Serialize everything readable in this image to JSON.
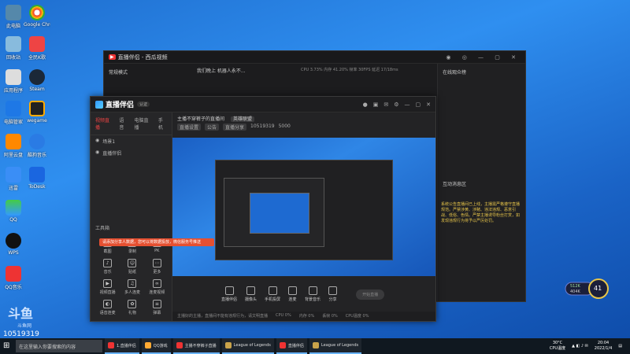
{
  "desktop_icons": [
    "此电脑",
    "Google Chrome",
    "回收站",
    "全民K歌",
    "应用程序",
    "Steam",
    "电脑管家",
    "wegame",
    "阿里云盘",
    "酷狗音乐",
    "迅雷",
    "ToDesk",
    "QQ",
    "WPS",
    "QQ音乐"
  ],
  "bg_window": {
    "title": "直播伴侣 - 西瓜视频",
    "mode": "常规模式",
    "live_title": "我们晚上 机器人永不...",
    "stats": "CPU 3.73%  内存 41.20%  帧率 30FPS  延迟 17/18ms",
    "right_title": "在线观众榜",
    "chat_title": "互动消息区",
    "chat_system": "系统公告直播间已上线，主播需严格遵守直播规范。严禁涉黄、涉赌、违法违规、恶意引战、低俗、色情。严禁主播诱导粉丝打赏，如发现违规行为将予以严厉处罚。"
  },
  "main_window": {
    "title": "直播伴侣",
    "tag": "认证",
    "left_tabs": [
      "视频直播",
      "语音",
      "电脑直播",
      "手机"
    ],
    "scene_label": "场景1",
    "source_label": "直播伴侣",
    "tools_label": "工具箱",
    "tools": [
      "截图",
      "录制",
      "PK",
      "音乐",
      "贴纸",
      "更多",
      "视频直播",
      "多人连麦",
      "连麦视频",
      "语音连麦",
      "礼物",
      "弹幕"
    ],
    "toast": "请添加分享人数据，您可以将数据投放，微信服务号推送",
    "live_title": "主播不穿裤子的直播间",
    "category": "英雄联盟",
    "chips": [
      "直播设置",
      "公告",
      "直播分享",
      "5000"
    ],
    "room_id": "10519319",
    "controls": [
      "直播伴侣",
      "摄像头",
      "手机投屏",
      "连麦",
      "背景音乐",
      "分享"
    ],
    "start_live": "开始直播",
    "status": [
      "主播好的主播，直播间不能有违规行为，请文明直播",
      "CPU 0%",
      "内存 0%",
      "丢帧 0%",
      "CPU温度 0%"
    ]
  },
  "taskbar": {
    "search_placeholder": "在这里输入你要搜索的内容",
    "apps": [
      {
        "label": "1.直播伴侣",
        "color": "#e33"
      },
      {
        "label": "QQ游戏",
        "color": "#fa3"
      },
      {
        "label": "主播不穿裤子直播",
        "color": "#e33"
      },
      {
        "label": "League of Legends",
        "color": "#c9a34a"
      },
      {
        "label": "直播伴侣",
        "color": "#e33"
      },
      {
        "label": "League of Legends",
        "color": "#c9a34a"
      }
    ],
    "temp": "30°C",
    "cpu": "CPU温度",
    "time": "20:04",
    "date": "2022/1/4"
  },
  "overlay_badge": {
    "value": "41",
    "line1": "512K",
    "line2": "404K"
  },
  "watermark": {
    "brand": "斗鱼",
    "sub": "斗鱼网",
    "room": "10519319"
  }
}
